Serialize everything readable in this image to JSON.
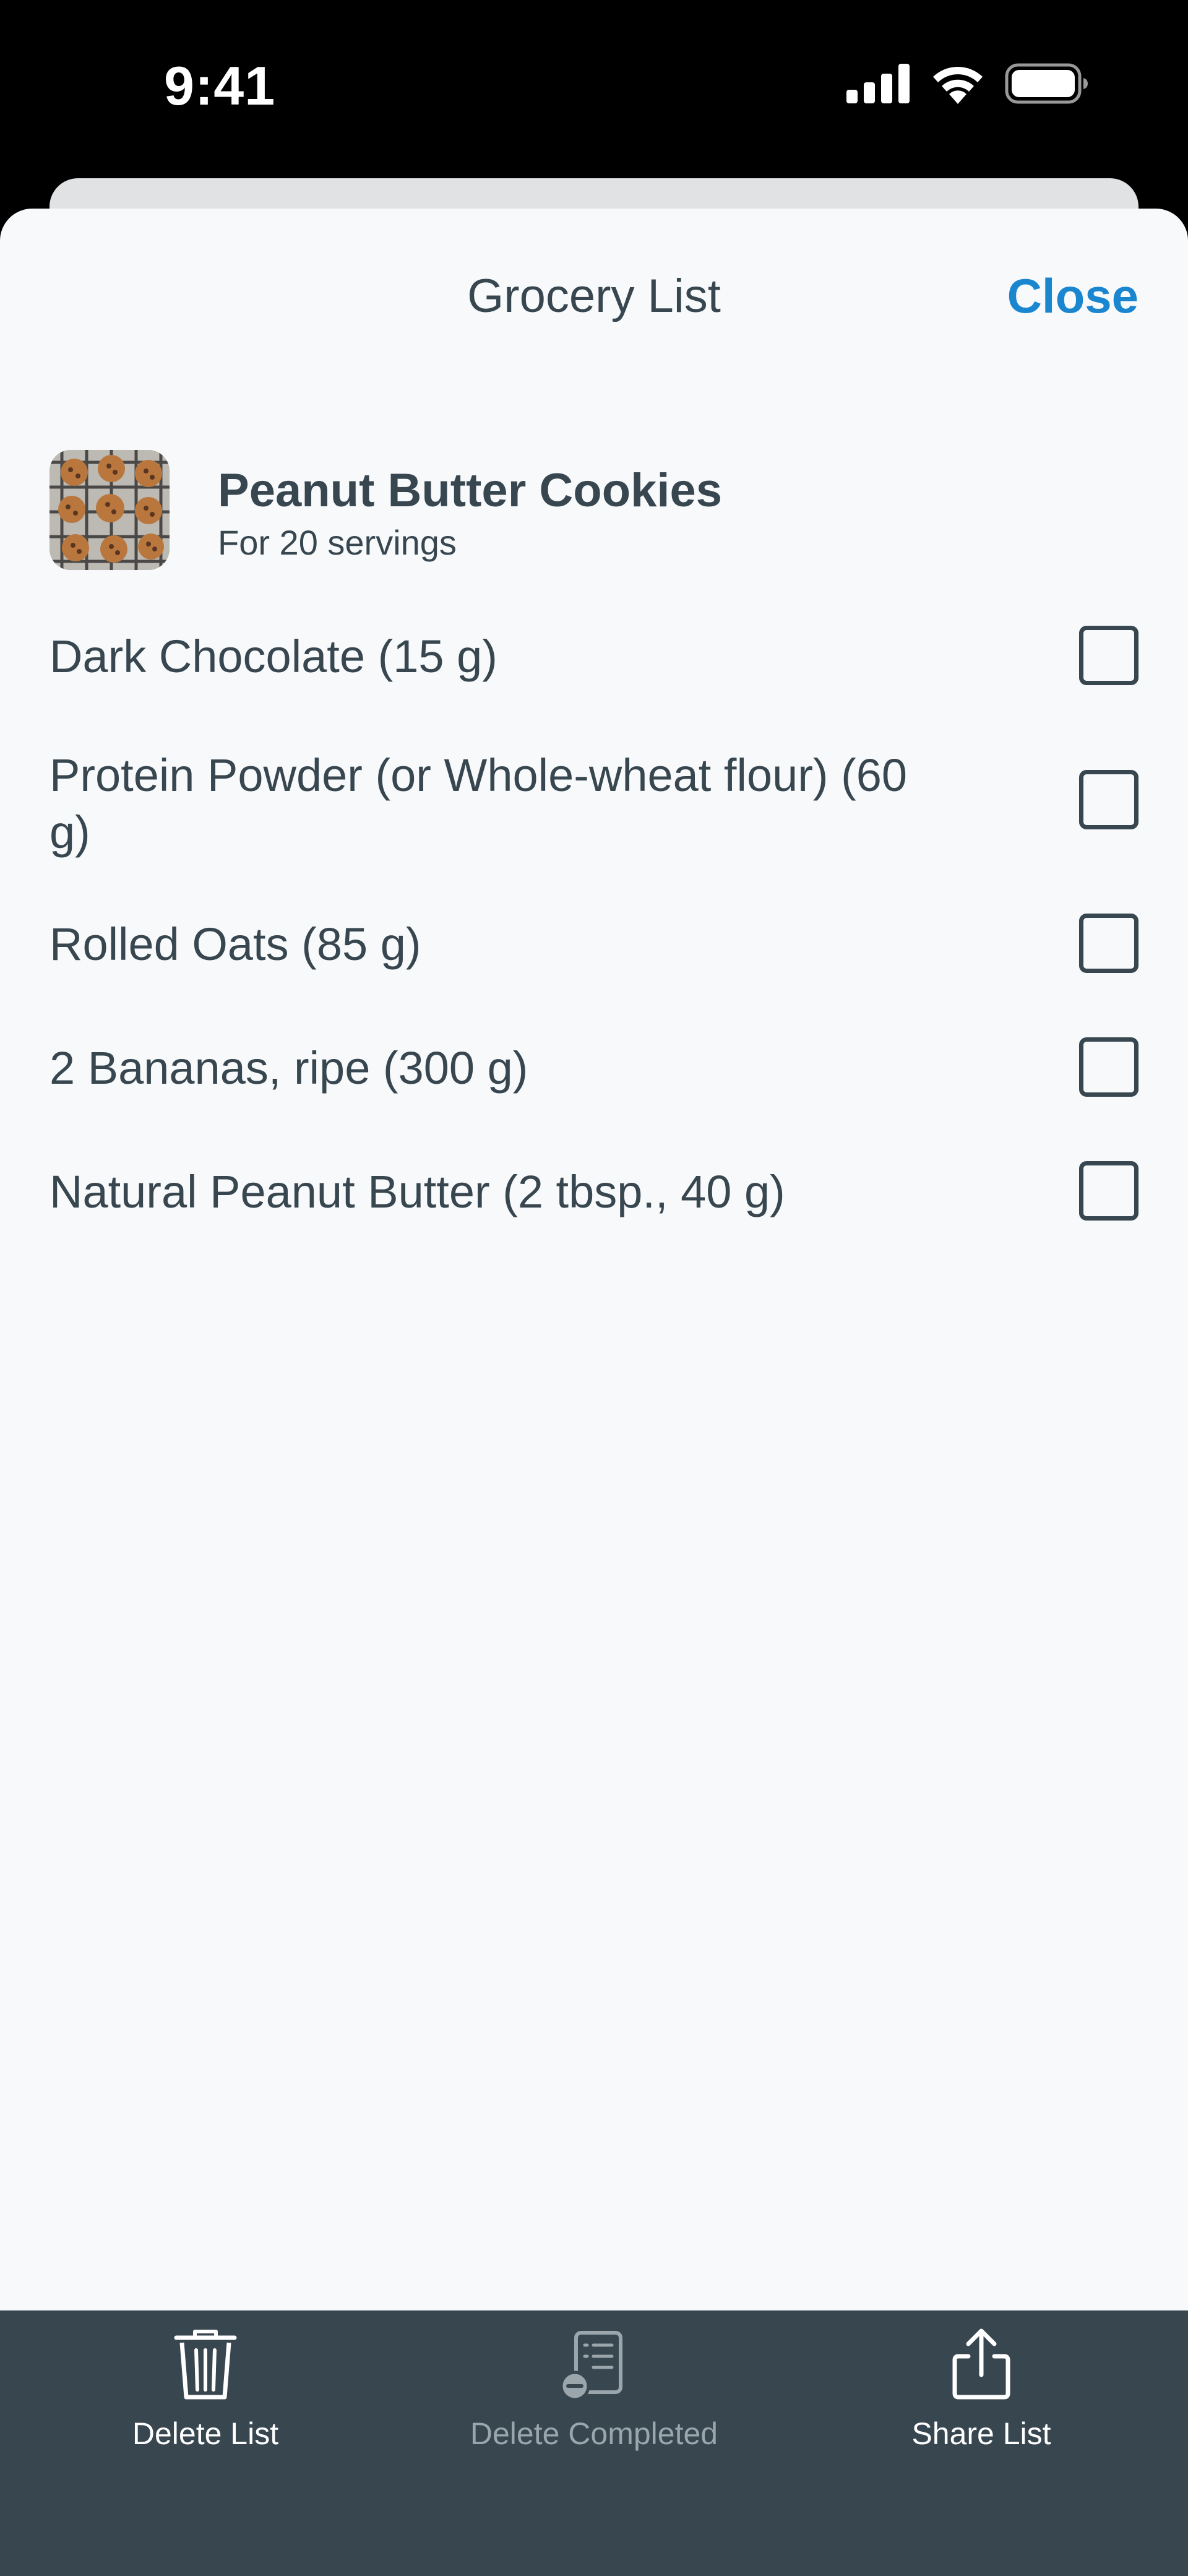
{
  "status_bar": {
    "time": "9:41"
  },
  "sheet": {
    "title": "Grocery List",
    "close_label": "Close"
  },
  "recipe": {
    "name": "Peanut Butter Cookies",
    "servings": "For 20 servings"
  },
  "items": [
    {
      "label": "Dark Chocolate (15 g)",
      "checked": false
    },
    {
      "label": "Protein Powder (or Whole-wheat flour) (60 g)",
      "checked": false
    },
    {
      "label": "Rolled Oats (85 g)",
      "checked": false
    },
    {
      "label": "2 Bananas, ripe (300 g)",
      "checked": false
    },
    {
      "label": "Natural Peanut Butter (2 tbsp., 40 g)",
      "checked": false
    }
  ],
  "toolbar": {
    "delete_list": {
      "label": "Delete List",
      "icon": "trash-icon"
    },
    "delete_completed": {
      "label": "Delete Completed",
      "icon": "list-remove-icon",
      "enabled": false
    },
    "share_list": {
      "label": "Share List",
      "icon": "share-icon"
    }
  },
  "colors": {
    "accent": "#1a86cf",
    "text": "#37464f",
    "background": "#f7f9fb",
    "toolbar": "#37464f"
  }
}
